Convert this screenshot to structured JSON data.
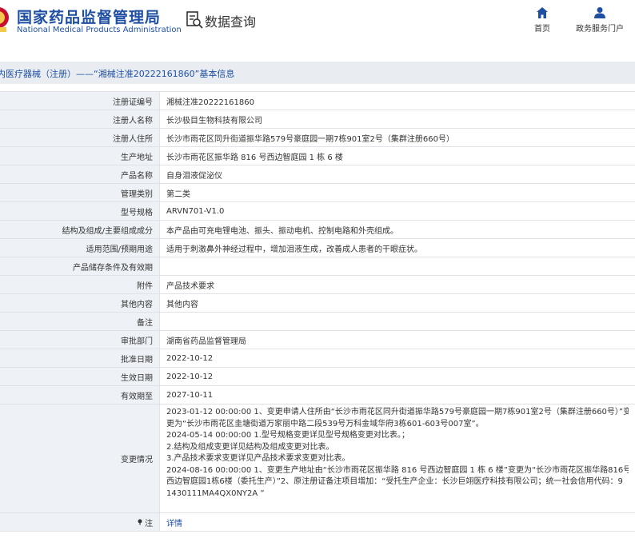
{
  "header": {
    "logo_cn": "国家药品监督管理局",
    "logo_en": "National Medical Products Administration",
    "query_title": "数据查询",
    "nav": [
      {
        "label": "首页",
        "icon": "home-icon"
      },
      {
        "label": "政务服务门户",
        "icon": "user-icon"
      }
    ]
  },
  "title_bar": {
    "text": "内医疗器械（注册）——“湘械注准20222161860”基本信息"
  },
  "rows": [
    {
      "label": "注册证编号",
      "value": "湘械注准20222161860"
    },
    {
      "label": "注册人名称",
      "value": "长沙极目生物科技有限公司"
    },
    {
      "label": "注册人住所",
      "value": "长沙市雨花区同升街道振华路579号豪庭园一期7栋901室2号（集群注册660号）"
    },
    {
      "label": "生产地址",
      "value": "长沙市雨花区振华路 816 号西边智庭园 1 栋 6 楼"
    },
    {
      "label": "产品名称",
      "value": "自身泪液促泌仪"
    },
    {
      "label": "管理类别",
      "value": "第二类"
    },
    {
      "label": "型号规格",
      "value": "ARVN701-V1.0"
    },
    {
      "label": "结构及组成/主要组成成分",
      "value": "本产品由可充电锂电池、振头、振动电机、控制电路和外壳组成。"
    },
    {
      "label": "适用范围/预期用途",
      "value": "适用于刺激鼻外神经过程中，增加泪液生成，改善成人患者的干眼症状。"
    },
    {
      "label": "产品储存条件及有效期",
      "value": ""
    },
    {
      "label": "附件",
      "value": "产品技术要求"
    },
    {
      "label": "其他内容",
      "value": "其他内容"
    },
    {
      "label": "备注",
      "value": ""
    },
    {
      "label": "审批部门",
      "value": "湖南省药品监督管理局"
    },
    {
      "label": "批准日期",
      "value": "2022-10-12"
    },
    {
      "label": "生效日期",
      "value": "2022-10-12"
    },
    {
      "label": "有效期至",
      "value": "2027-10-11"
    }
  ],
  "changes": {
    "label": "变更情况",
    "lines": [
      "2023-01-12 00:00:00 1、变更申请人住所由“长沙市雨花区同升街道振华路579号豪庭园一期7栋901室2号（集群注册660号）”变",
      "更为“长沙市雨花区圭塘街道万家丽中路二段539号万科金域华府3栋601-603号007室”。",
      "2024-05-14 00:00:00 1.型号规格变更详见型号规格变更对比表。；",
      "2.结构及组成变更详见结构及组成变更对比表。",
      "3.产品技术要求变更详见产品技术要求变更对比表。",
      "2024-08-16 00:00:00 1、变更生产地址由“长沙市雨花区振华路 816 号西边智庭园 1 栋 6 楼”变更为“长沙市雨花区振华路816号",
      "西边智庭园1栋6楼（委托生产）”2、原注册证备注项目增加：“受托生产企业：长沙巨翊医疗科技有限公司；统一社会信用代码：9",
      "1430111MA4QX0NY2A ”"
    ]
  },
  "note_row": {
    "label": "注",
    "link": "详情"
  }
}
